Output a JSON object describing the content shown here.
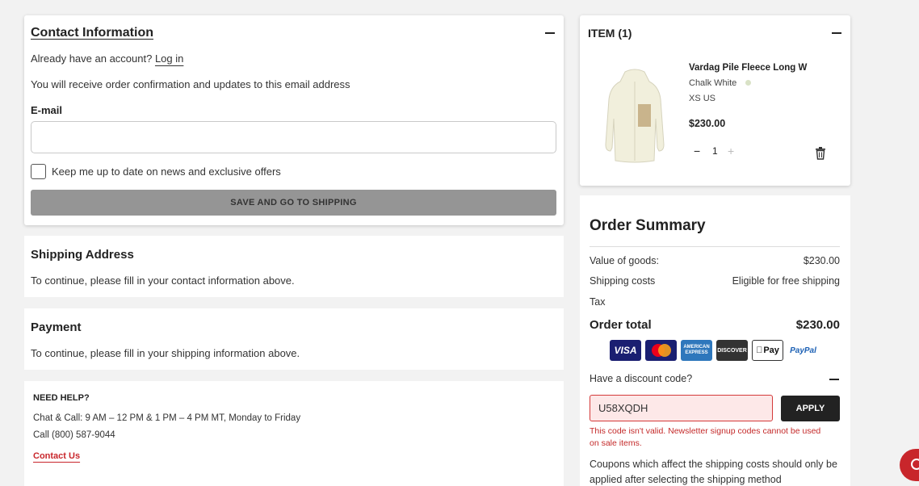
{
  "contact": {
    "title": "Contact Information",
    "already_account": "Already have an account?",
    "login_link": "Log in",
    "info_text": "You will receive order confirmation and updates to this email address",
    "email_label": "E-mail",
    "email_value": "",
    "newsletter_label": "Keep me up to date on news and exclusive offers",
    "save_button": "SAVE AND GO TO SHIPPING"
  },
  "shipping": {
    "title": "Shipping Address",
    "text": "To continue, please fill in your contact information above."
  },
  "payment": {
    "title": "Payment",
    "text": "To continue, please fill in your shipping information above."
  },
  "help": {
    "title": "NEED HELP?",
    "hours": "Chat & Call: 9 AM – 12 PM & 1 PM – 4 PM MT, Monday to Friday",
    "phone": "Call (800) 587-9044",
    "contact_link": "Contact Us"
  },
  "item": {
    "header": "ITEM (1)",
    "name": "Vardag Pile Fleece Long W",
    "color": "Chalk White",
    "size": "XS US",
    "price": "$230.00",
    "quantity": "1"
  },
  "summary": {
    "title": "Order Summary",
    "value_label": "Value of goods:",
    "value_amount": "$230.00",
    "shipping_label": "Shipping costs",
    "shipping_value": "Eligible for free shipping",
    "tax_label": "Tax",
    "total_label": "Order total",
    "total_amount": "$230.00",
    "payment_methods": [
      "VISA",
      "Mastercard",
      "AMERICAN EXPRESS",
      "DISCOVER",
      "Pay",
      "PayPal"
    ],
    "discount_question": "Have a discount code?",
    "discount_code": "U58XQDH",
    "apply_button": "APPLY",
    "error_text": "This code isn't valid. Newsletter signup codes cannot be used on sale items.",
    "coupon_note": "Coupons which affect the shipping costs should only be applied after selecting the shipping method"
  },
  "colors": {
    "accent_red": "#c8262b",
    "error_red": "#c42a2a",
    "button_gray": "#959595",
    "apply_black": "#222222"
  }
}
